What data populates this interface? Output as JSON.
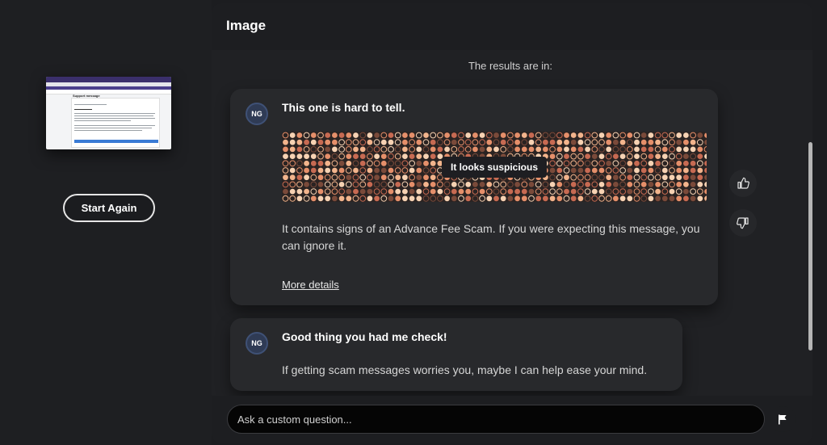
{
  "sidebar": {
    "thumbnail": {
      "title": "Support message",
      "icon": "screenshot-thumbnail"
    },
    "start_again_label": "Start Again"
  },
  "header": {
    "title": "Image"
  },
  "results": {
    "intro": "The results are in:"
  },
  "messages": [
    {
      "avatar": "NG",
      "heading": "This one is hard to tell.",
      "verdict": "It looks suspicious",
      "body": "It contains signs of an Advance Fee Scam. If you were expecting this message, you can ignore it.",
      "link": "More details"
    },
    {
      "avatar": "NG",
      "heading": "Good thing you had me check!",
      "body": "If getting scam messages worries you, maybe I can help ease your mind."
    }
  ],
  "feedback": {
    "thumbs_up_icon": "thumbs-up-icon",
    "thumbs_down_icon": "thumbs-down-icon"
  },
  "composer": {
    "placeholder": "Ask a custom question...",
    "flag_icon": "flag-icon"
  },
  "colors": {
    "background": "#1c1d20",
    "card": "#28292c",
    "input": "#050505",
    "avatar": "#2f3b55",
    "dot_colors": [
      "#f6d2b3",
      "#f2b48c",
      "#e58f6a",
      "#c76a52",
      "#7a4a3a"
    ]
  }
}
